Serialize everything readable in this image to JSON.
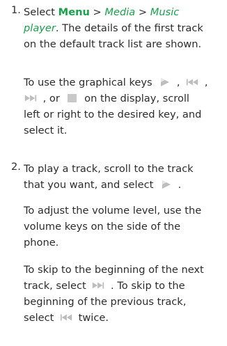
{
  "step1": {
    "number": "1.",
    "a1": "Select ",
    "menu": "Menu",
    "sep1": " > ",
    "media": "Media",
    "sep2": " > ",
    "music": "Music",
    "player": "player",
    "after_player": ". The details of the first track",
    "line3": "on the default track list are shown.",
    "keys_a": "To use the graphical keys",
    "keys_sep1": " ,",
    "keys_sep2": " ,",
    "keys_or": " , or",
    "keys_b": " on the display, scroll",
    "keys_line3": "left or right to the desired key, and",
    "keys_line4": "select it."
  },
  "step2": {
    "number": "2.",
    "l1": "To play a track, scroll to the track",
    "l2a": "that you want, and select",
    "l2b": " .",
    "vol1": "To adjust the volume level, use the",
    "vol2": "volume keys on the side of the",
    "vol3": "phone.",
    "skip1": "To skip to the beginning of the next",
    "skip2a": "track, select",
    "skip2b": " . To skip to the",
    "skip3": "beginning of the previous track,",
    "skip4a": "select",
    "skip4b": " twice."
  },
  "icons": {
    "play": "play-icon",
    "previous": "previous-track-icon",
    "next": "next-track-icon",
    "stop": "stop-icon"
  },
  "colors": {
    "link": "#17a24a",
    "text": "#2c2c2c",
    "icon": "#c8c8c8"
  }
}
